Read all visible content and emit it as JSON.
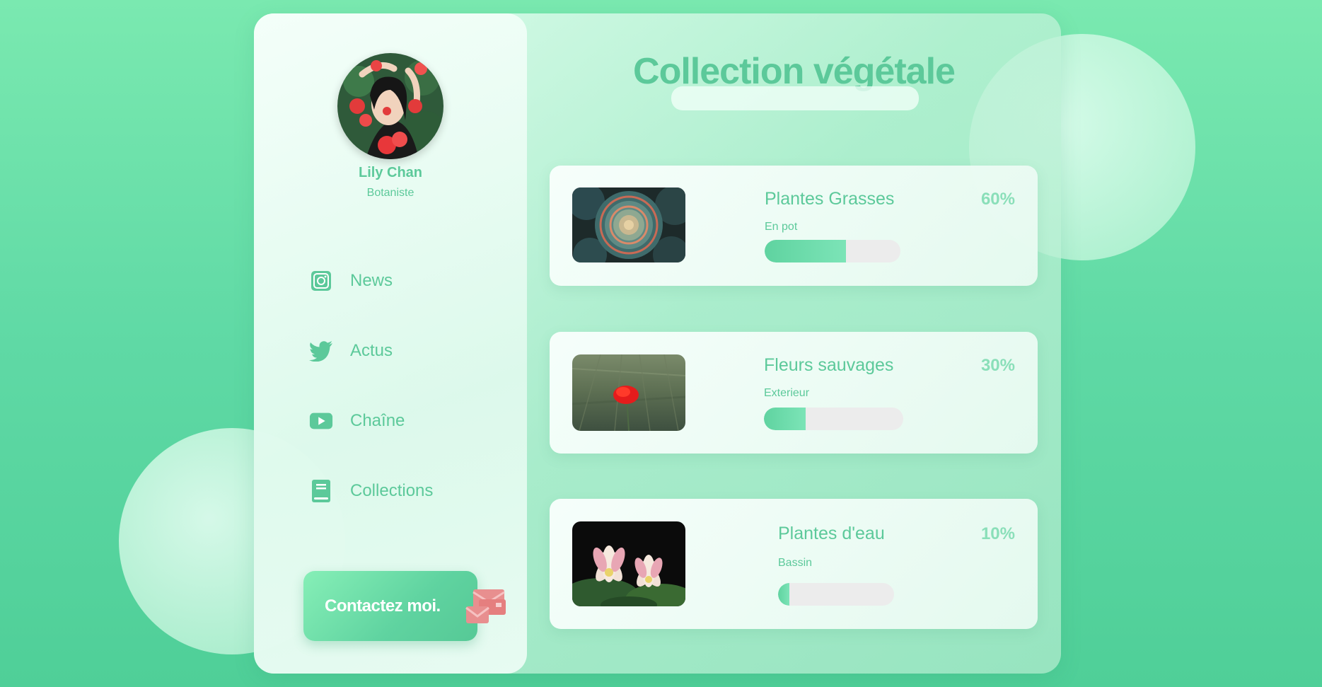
{
  "profile": {
    "name": "Lily Chan",
    "role": "Botaniste"
  },
  "nav": [
    {
      "label": "News",
      "icon": "instagram-icon"
    },
    {
      "label": "Actus",
      "icon": "twitter-icon"
    },
    {
      "label": "Chaîne",
      "icon": "youtube-icon"
    },
    {
      "label": "Collections",
      "icon": "book-icon"
    }
  ],
  "contact": {
    "label": "Contactez moi.",
    "icon": "mail-icon"
  },
  "main": {
    "title": "Collection végétale",
    "search_value": ""
  },
  "cards": [
    {
      "title": "Plantes Grasses",
      "subtitle": "En pot",
      "percent": "60%",
      "progress": 0.6,
      "image": "succulent-photo"
    },
    {
      "title": "Fleurs sauvages",
      "subtitle": "Exterieur",
      "percent": "30%",
      "progress": 0.3,
      "image": "poppy-photo"
    },
    {
      "title": "Plantes d'eau",
      "subtitle": "Bassin",
      "percent": "10%",
      "progress": 0.1,
      "image": "lotus-photo"
    }
  ],
  "colors": {
    "accent": "#5cc99a",
    "accent_light": "#8adfb9",
    "track": "#ececec",
    "contact_icon": "#e88f8f"
  }
}
